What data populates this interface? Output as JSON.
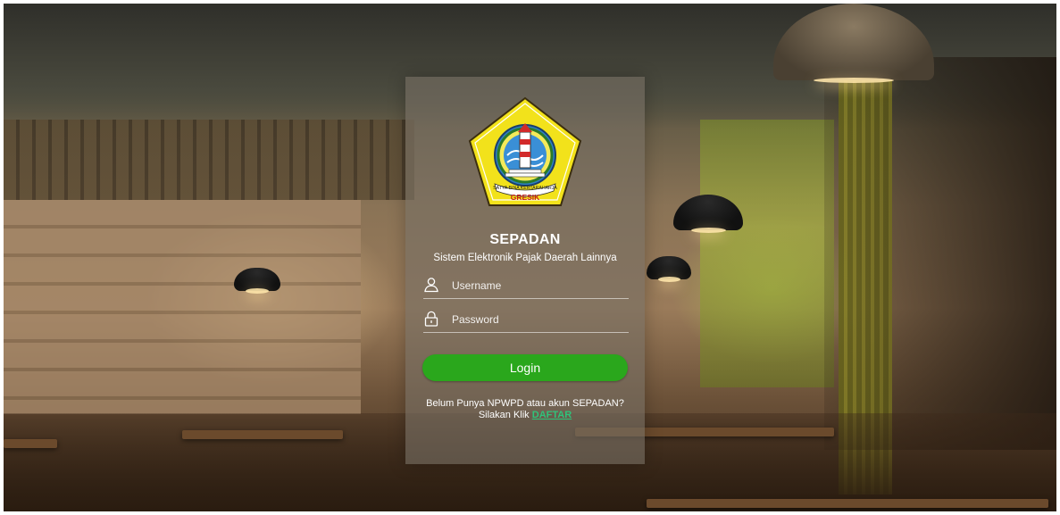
{
  "app": {
    "title": "SEPADAN",
    "subtitle": "Sistem Elektronik Pajak Daerah Lainnya"
  },
  "logo": {
    "region_name": "GRESIK",
    "motto": "SATYA BINA KERTARAHARJA",
    "icon": "gresik-regency-emblem"
  },
  "form": {
    "username_placeholder": "Username",
    "password_placeholder": "Password",
    "username_icon": "user-icon",
    "password_icon": "lock-icon",
    "login_label": "Login"
  },
  "register": {
    "prompt": "Belum Punya NPWPD atau akun SEPADAN?",
    "action_prefix": "Silakan Klik",
    "link_label": "DAFTAR"
  },
  "colors": {
    "login_button": "#2aa71c",
    "register_link": "#2fc37a",
    "panel_overlay": "rgba(120,112,100,0.62)"
  }
}
